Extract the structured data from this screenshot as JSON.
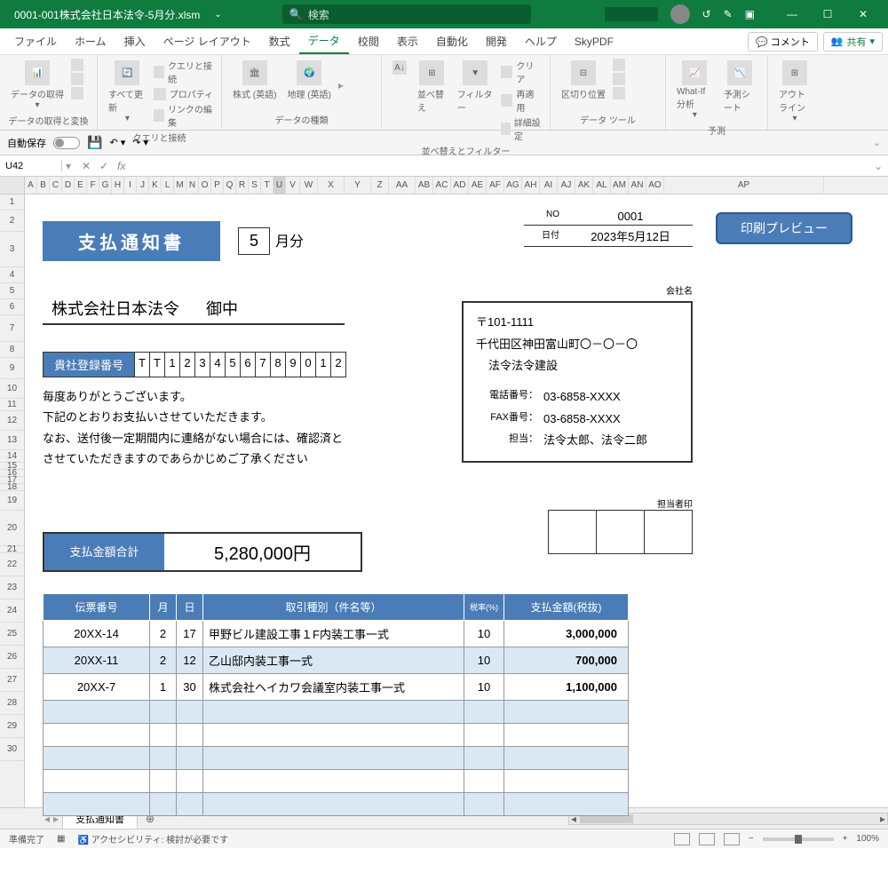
{
  "titlebar": {
    "filename": "0001-001株式会社日本法令-5月分.xlsm",
    "search_placeholder": "検索"
  },
  "menu": {
    "items": [
      "ファイル",
      "ホーム",
      "挿入",
      "ページ レイアウト",
      "数式",
      "データ",
      "校閲",
      "表示",
      "自動化",
      "開発",
      "ヘルプ",
      "SkyPDF"
    ],
    "active": 5,
    "comment": "コメント",
    "share": "共有"
  },
  "ribbon": {
    "g1": {
      "label": "データの取得と変換",
      "btn": "データの取得"
    },
    "g2": {
      "label": "クエリと接続",
      "btn": "すべて更新",
      "sub": [
        "クエリと接続",
        "プロパティ",
        "リンクの編集"
      ]
    },
    "g3": {
      "label": "データの種類",
      "btn1": "株式 (英語)",
      "btn2": "地理 (英語)"
    },
    "g4": {
      "label": "並べ替えとフィルター",
      "sort": "並べ替え",
      "filter": "フィルター",
      "sub": [
        "クリア",
        "再適用",
        "詳細設定"
      ]
    },
    "g5": {
      "label": "データ ツール",
      "btn": "区切り位置"
    },
    "g6": {
      "label": "予測",
      "btn1": "What-If 分析",
      "btn2": "予測シート"
    },
    "g7": {
      "btn": "アウトライン"
    }
  },
  "qat": {
    "autosave_label": "自動保存",
    "autosave_state": "オフ"
  },
  "formula": {
    "cell": "U42"
  },
  "cols": [
    "A",
    "B",
    "C",
    "D",
    "E",
    "F",
    "G",
    "H",
    "I",
    "J",
    "K",
    "L",
    "M",
    "N",
    "O",
    "P",
    "Q",
    "R",
    "S",
    "T",
    "U",
    "V",
    "W",
    "X",
    "Y",
    "Z",
    "AA",
    "AB",
    "AC",
    "AD",
    "AE",
    "AF",
    "AG",
    "AH",
    "AI",
    "AJ",
    "AK",
    "AL",
    "AM",
    "AN",
    "AO",
    "AP"
  ],
  "rows": [
    "1",
    "2",
    "3",
    "4",
    "5",
    "6",
    "7",
    "8",
    "9",
    "10",
    "11",
    "12",
    "13",
    "14",
    "15",
    "16",
    "17",
    "18",
    "19",
    "20",
    "21",
    "22",
    "23",
    "24",
    "25",
    "26",
    "27",
    "28",
    "29",
    "30"
  ],
  "doc": {
    "title": "支払通知書",
    "month": "5",
    "month_suffix": "月分",
    "no_label": "NO",
    "no_value": "0001",
    "date_label": "日付",
    "date_value": "2023年5月12日",
    "print_btn": "印刷プレビュー",
    "recipient": "株式会社日本法令",
    "recipient_suffix": "御中",
    "reg_label": "貴社登録番号",
    "reg_cells": [
      "T",
      "T",
      "1",
      "2",
      "3",
      "4",
      "5",
      "6",
      "7",
      "8",
      "9",
      "0",
      "1",
      "2"
    ],
    "body": [
      "毎度ありがとうございます。",
      "下記のとおりお支払いさせていただきます。",
      "なお、送付後一定期間内に連絡がない場合には、確認済とさせていただきますのであらかじめご了承ください"
    ],
    "company_label": "会社名",
    "company": {
      "postal": "〒101-1111",
      "addr": "千代田区神田富山町〇－〇－〇",
      "name": "法令法令建設",
      "tel_label": "電話番号：",
      "tel": "03-6858-XXXX",
      "fax_label": "FAX番号：",
      "fax": "03-6858-XXXX",
      "tantou_label": "担当：",
      "tantou": "法令太郎、法令二郎"
    },
    "tantou_stamp_label": "担当者印",
    "total_label": "支払金額合計",
    "total_value": "5,280,000円",
    "table": {
      "headers": [
        "伝票番号",
        "月",
        "日",
        "取引種別（件名等）",
        "税率(%)",
        "支払金額(税抜)"
      ],
      "rows": [
        {
          "no": "20XX-14",
          "m": "2",
          "d": "17",
          "desc": "甲野ビル建設工事１F内装工事一式",
          "rate": "10",
          "amt": "3,000,000"
        },
        {
          "no": "20XX-11",
          "m": "2",
          "d": "12",
          "desc": "乙山邸内装工事一式",
          "rate": "10",
          "amt": "700,000"
        },
        {
          "no": "20XX-7",
          "m": "1",
          "d": "30",
          "desc": "株式会社ヘイカワ会議室内装工事一式",
          "rate": "10",
          "amt": "1,100,000"
        }
      ]
    }
  },
  "tabs": {
    "sheet": "支払通知書"
  },
  "status": {
    "ready": "準備完了",
    "acc": "アクセシビリティ: 検討が必要です",
    "zoom": "100%"
  }
}
